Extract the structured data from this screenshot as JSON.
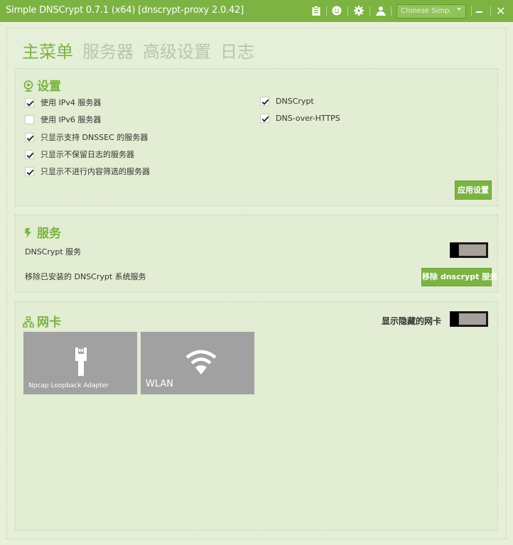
{
  "window": {
    "title": "Simple DNSCrypt 0.7.1 (x64) [dnscrypt-proxy 2.0.42]",
    "language": "Chinese Simp."
  },
  "nav": {
    "tabs": [
      {
        "label": "主菜单",
        "active": true
      },
      {
        "label": "服务器",
        "active": false
      },
      {
        "label": "高级设置",
        "active": false
      },
      {
        "label": "日志",
        "active": false
      }
    ]
  },
  "settings": {
    "title": "设置",
    "left_options": [
      {
        "label": "使用 IPv4 服务器",
        "checked": true
      },
      {
        "label": "使用 IPv6 服务器",
        "checked": false
      },
      {
        "label": "只显示支持 DNSSEC 的服务器",
        "checked": true
      },
      {
        "label": "只显示不保留日志的服务器",
        "checked": true
      },
      {
        "label": "只显示不进行内容筛选的服务器",
        "checked": true
      }
    ],
    "right_options": [
      {
        "label": "DNSCrypt",
        "checked": true
      },
      {
        "label": "DNS-over-HTTPS",
        "checked": true
      }
    ],
    "apply_label": "应用设置"
  },
  "service": {
    "title": "服务",
    "service_label": "DNSCrypt 服务",
    "remove_text": "移除已安装的 DNSCrypt 系统服务",
    "remove_button": "移除 dnscrypt 服务",
    "toggle_on": false
  },
  "network": {
    "title": "网卡",
    "show_hidden_label": "显示隐藏的网卡",
    "show_hidden_on": false,
    "adapters": [
      {
        "name": "Npcap Loopback Adapter",
        "icon": "ethernet-plug-icon"
      },
      {
        "name": "WLAN",
        "icon": "wifi-icon"
      }
    ]
  },
  "colors": {
    "accent": "#7cb342",
    "panel": "#e6efda",
    "tile": "#a1a1a1"
  }
}
